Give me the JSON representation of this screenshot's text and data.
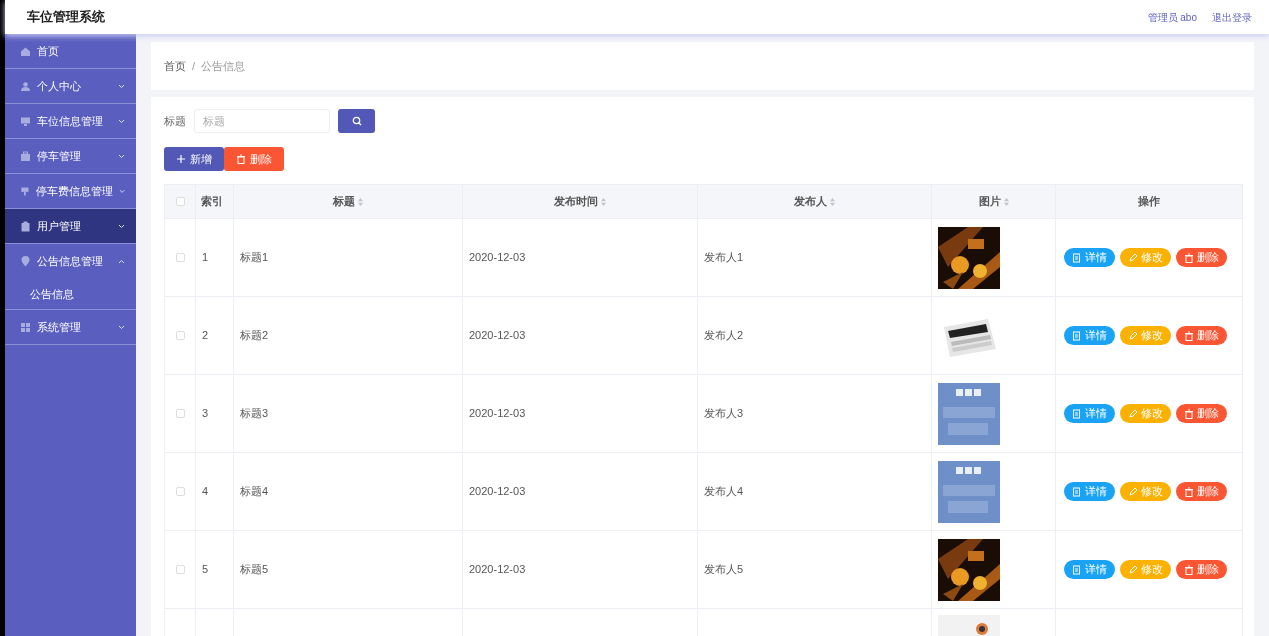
{
  "header": {
    "title": "车位管理系统",
    "user": "管理员 abo",
    "logout": "退出登录"
  },
  "sidebar": {
    "items": [
      {
        "kind": "home",
        "label": "首页",
        "selected": false
      },
      {
        "kind": "user",
        "label": "个人中心",
        "selected": false,
        "expanded": false
      },
      {
        "kind": "monitor",
        "label": "车位信息管理",
        "selected": false,
        "expanded": false
      },
      {
        "kind": "briefcase",
        "label": "停车管理",
        "selected": false,
        "expanded": false
      },
      {
        "kind": "cup",
        "label": "停车费信息管理",
        "selected": false,
        "expanded": false
      },
      {
        "kind": "clipboard",
        "label": "用户管理",
        "selected": true,
        "expanded": false
      },
      {
        "kind": "pin",
        "label": "公告信息管理",
        "selected": false,
        "expanded": true,
        "children": [
          {
            "label": "公告信息",
            "selected": false
          }
        ]
      },
      {
        "kind": "grid",
        "label": "系统管理",
        "selected": false,
        "expanded": false
      }
    ]
  },
  "breadcrumb": {
    "items": [
      "首页",
      "公告信息"
    ],
    "separator": "/"
  },
  "search": {
    "label": "标题",
    "placeholder": "标题"
  },
  "actions": [
    {
      "kind": "add",
      "label": "新增"
    },
    {
      "kind": "delete",
      "label": "删除"
    }
  ],
  "table": {
    "select_all_checked": false,
    "columns": [
      {
        "label": "索引",
        "sortable": false
      },
      {
        "label": "标题",
        "sortable": true
      },
      {
        "label": "发布时间",
        "sortable": true
      },
      {
        "label": "发布人",
        "sortable": true
      },
      {
        "label": "图片",
        "sortable": true
      },
      {
        "label": "操作",
        "sortable": false
      }
    ],
    "rows": [
      {
        "checked": false,
        "index": "1",
        "title": "标题1",
        "time": "2020-12-03",
        "author": "发布人1",
        "picture": {
          "kind": "picture"
        },
        "buttons": [
          "详情",
          "修改",
          "删除"
        ]
      },
      {
        "checked": false,
        "index": "2",
        "title": "标题2",
        "time": "2020-12-03",
        "author": "发布人2",
        "picture": {
          "kind": "picture"
        },
        "buttons": [
          "详情",
          "修改",
          "删除"
        ]
      },
      {
        "checked": false,
        "index": "3",
        "title": "标题3",
        "time": "2020-12-03",
        "author": "发布人3",
        "picture": {
          "kind": "picture"
        },
        "buttons": [
          "详情",
          "修改",
          "删除"
        ]
      },
      {
        "checked": false,
        "index": "4",
        "title": "标题4",
        "time": "2020-12-03",
        "author": "发布人4",
        "picture": {
          "kind": "picture"
        },
        "buttons": [
          "详情",
          "修改",
          "删除"
        ]
      },
      {
        "checked": false,
        "index": "5",
        "title": "标题5",
        "time": "2020-12-03",
        "author": "发布人5",
        "picture": {
          "kind": "picture"
        },
        "buttons": [
          "详情",
          "修改",
          "删除"
        ]
      },
      {
        "picture": {
          "kind": "picture"
        }
      }
    ]
  }
}
